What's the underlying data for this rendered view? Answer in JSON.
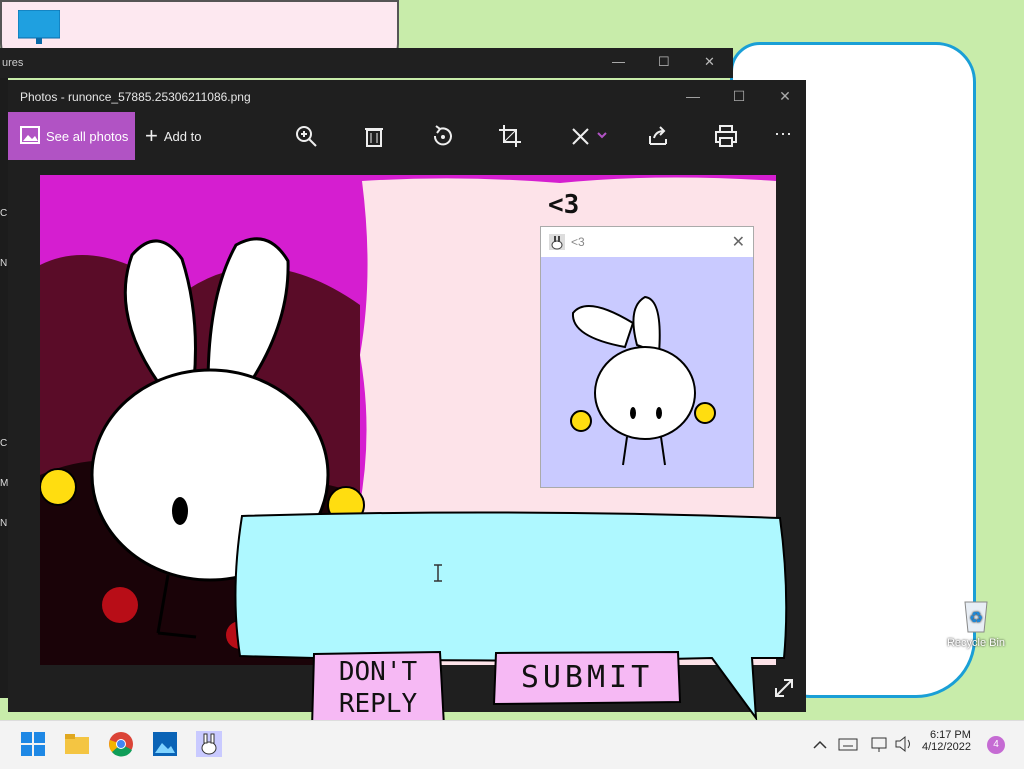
{
  "desktop": {
    "recycle_bin_label": "Recycle Bin"
  },
  "back_window": {
    "title_fragment": "ures"
  },
  "left_strip_letters": [
    "C",
    "N",
    "C",
    "M",
    "N"
  ],
  "photos": {
    "title": "Photos - runonce_57885.25306211086.png",
    "toolbar": {
      "see_all_label": "See all photos",
      "add_to_label": "Add to",
      "icons": [
        "zoom-in-icon",
        "delete-icon",
        "rotate-icon",
        "crop-icon",
        "edit-icon",
        "share-icon",
        "print-icon",
        "more-icon"
      ]
    }
  },
  "image": {
    "heart_text": "<3",
    "dialog_title": "<3",
    "speech_placeholder": "",
    "dont_reply_label": "DON'T REPLY",
    "submit_label": "SUBMIT"
  },
  "taskbar": {
    "time": "6:17 PM",
    "date": "4/12/2022",
    "notifications": "4"
  },
  "colors": {
    "accent": "#b153c4",
    "canvas_magenta": "#d51ed0",
    "dialog_bg": "#c9caff",
    "speech_bg": "#aef8ff",
    "button_bg": "#f6b9f4"
  }
}
